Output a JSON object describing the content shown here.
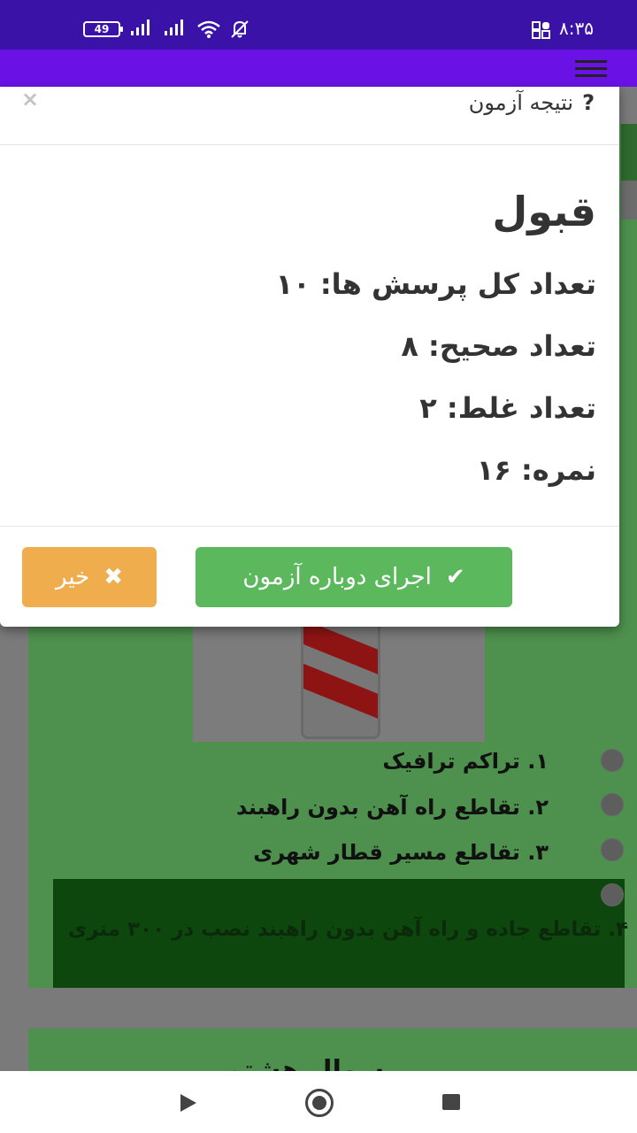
{
  "status_bar": {
    "battery": "49",
    "time": "۸:۳۵"
  },
  "background": {
    "options": [
      "۱. تراکم ترافیک",
      "۲. تقاطع راه آهن بدون راهبند",
      "۳. تقاطع مسیر قطار شهری",
      "۴. تقاطع جاده و راه آهن بدون راهبند نصب در ۳۰۰ متری"
    ],
    "next_card_title": "سوال هشتم"
  },
  "modal": {
    "close": "×",
    "title_icon": "?",
    "title": "نتیجه آزمون",
    "result": "قبول",
    "stats": [
      "تعداد کل پرسش ها: ۱۰",
      "تعداد صحیح: ۸",
      "تعداد غلط: ۲",
      "نمره: ۱۶"
    ],
    "retry_label": "اجرای دوباره آزمون",
    "no_label": "خیر"
  },
  "colors": {
    "status_bar": "#3a12a8",
    "app_bar": "#6a11e6",
    "success": "#5cb85c",
    "warning": "#f0ad4e"
  }
}
